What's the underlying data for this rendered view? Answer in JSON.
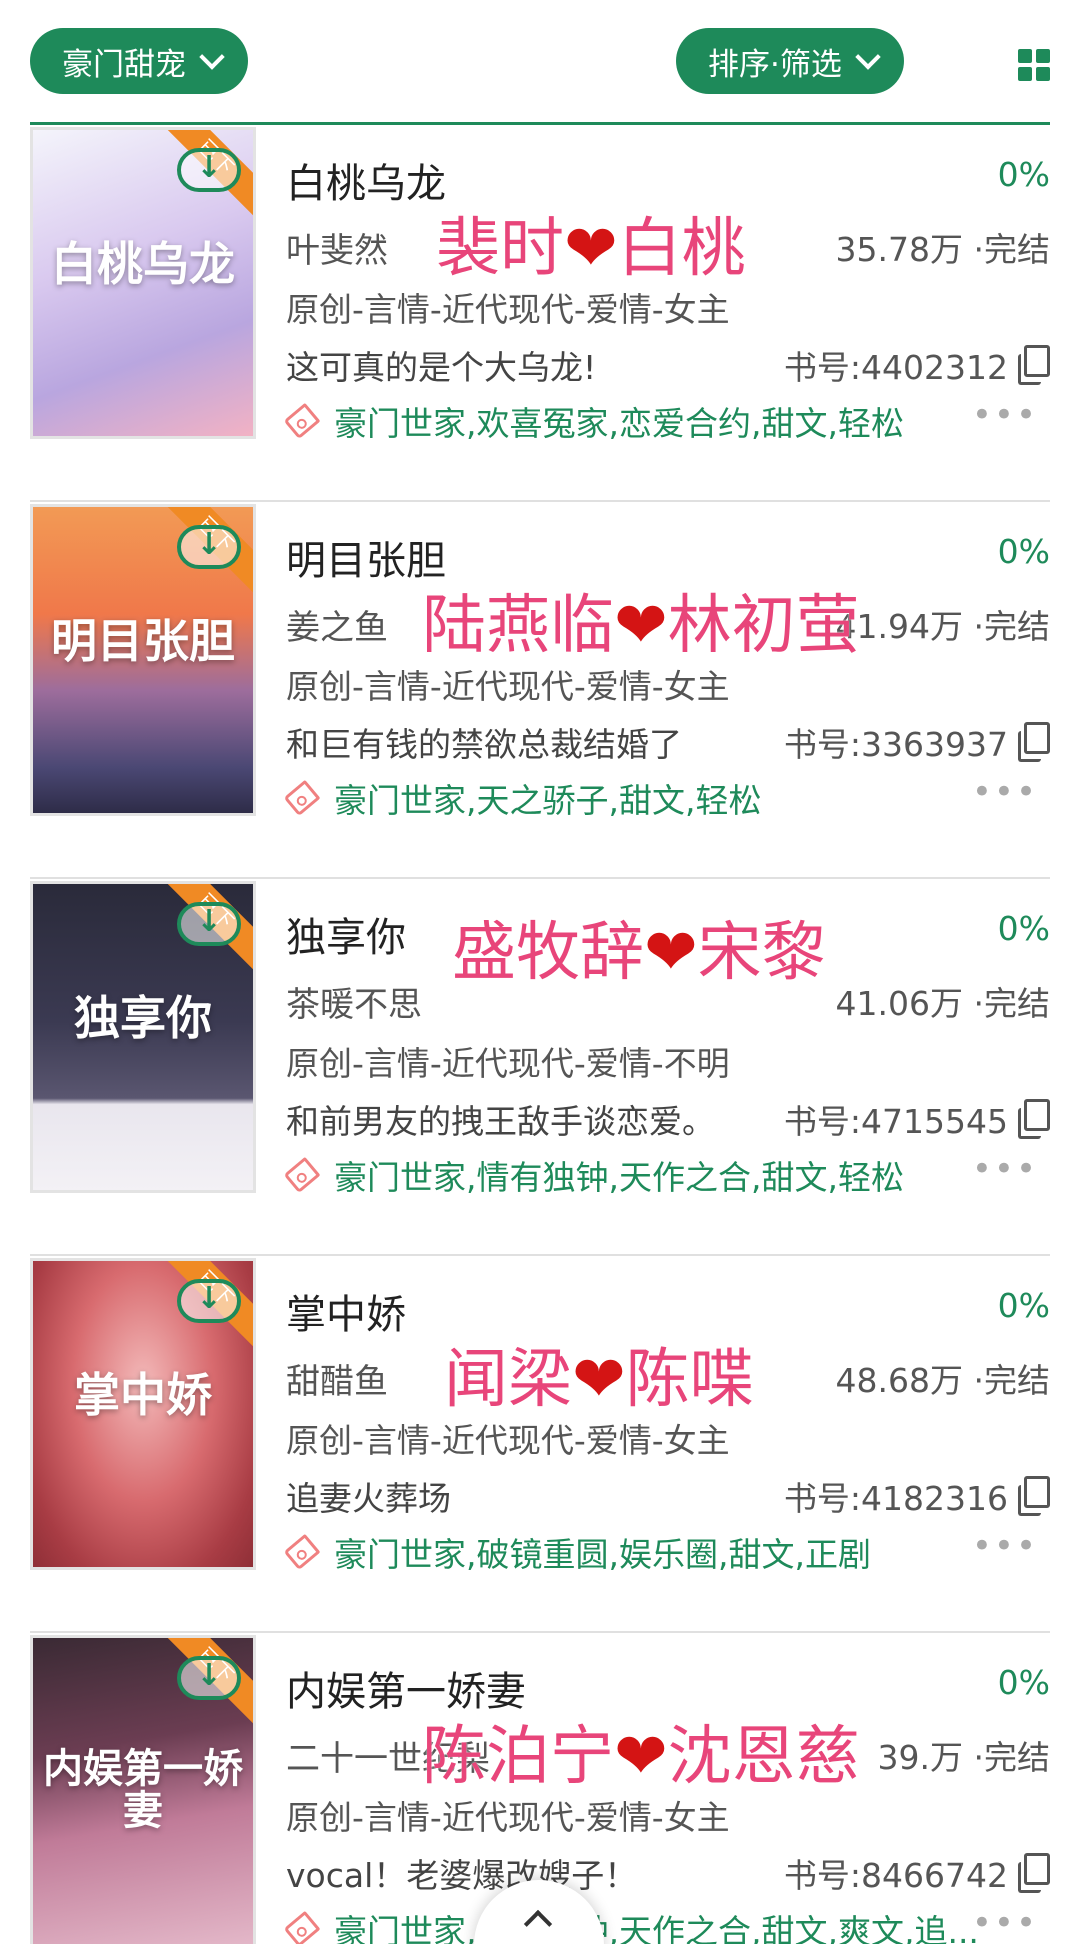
{
  "filters": {
    "category_label": "豪门甜宠",
    "sort_label": "排序·筛选"
  },
  "colors": {
    "accent": "#1e8a5a",
    "ship_text": "#e8457a",
    "heart": "#d41414"
  },
  "books": [
    {
      "title": "白桃乌龙",
      "cover_title": "白桃乌龙",
      "progress": "0%",
      "author": "叶斐然",
      "ship_a": "裴时",
      "ship_b": "白桃",
      "stats": "35.78万 ·完结",
      "genre": "原创-言情-近代现代-爱情-女主",
      "blurb": "这可真的是个大乌龙!",
      "book_no": "书号:4402312",
      "tags": "豪门世家,欢喜冤家,恋爱合约,甜文,轻松"
    },
    {
      "title": "明目张胆",
      "cover_title": "明目张胆",
      "progress": "0%",
      "author": "姜之鱼",
      "ship_a": "陆燕临",
      "ship_b": "林初萤",
      "stats": "41.94万 ·完结",
      "genre": "原创-言情-近代现代-爱情-女主",
      "blurb": "和巨有钱的禁欲总裁结婚了",
      "book_no": "书号:3363937",
      "tags": "豪门世家,天之骄子,甜文,轻松"
    },
    {
      "title": "独享你",
      "cover_title": "独享你",
      "progress": "0%",
      "author": "茶暖不思",
      "ship_a": "盛牧辞",
      "ship_b": "宋黎",
      "stats": "41.06万 ·完结",
      "genre": "原创-言情-近代现代-爱情-不明",
      "blurb": "和前男友的拽王敌手谈恋爱。",
      "book_no": "书号:4715545",
      "tags": "豪门世家,情有独钟,天作之合,甜文,轻松"
    },
    {
      "title": "掌中娇",
      "cover_title": "掌中娇",
      "progress": "0%",
      "author": "甜醋鱼",
      "ship_a": "闻梁",
      "ship_b": "陈喋",
      "stats": "48.68万 ·完结",
      "genre": "原创-言情-近代现代-爱情-女主",
      "blurb": "追妻火葬场",
      "book_no": "书号:4182316",
      "tags": "豪门世家,破镜重圆,娱乐圈,甜文,正剧"
    },
    {
      "title": "内娱第一娇妻",
      "cover_title": "内娱第一娇妻",
      "progress": "0%",
      "author": "二十一世纪梨",
      "ship_a": "陈泊宁",
      "ship_b": "沈恩慈",
      "stats": "39.万 ·完结",
      "genre": "原创-言情-近代现代-爱情-女主",
      "blurb": "vocal！老婆爆改嫂子！",
      "book_no": "书号:8466742",
      "tags": "豪门世家,情有独钟,天作之合,甜文,爽文,追..."
    }
  ],
  "ribbon_label": "已下",
  "heart_glyph": "❤",
  "more_glyph": "•••"
}
